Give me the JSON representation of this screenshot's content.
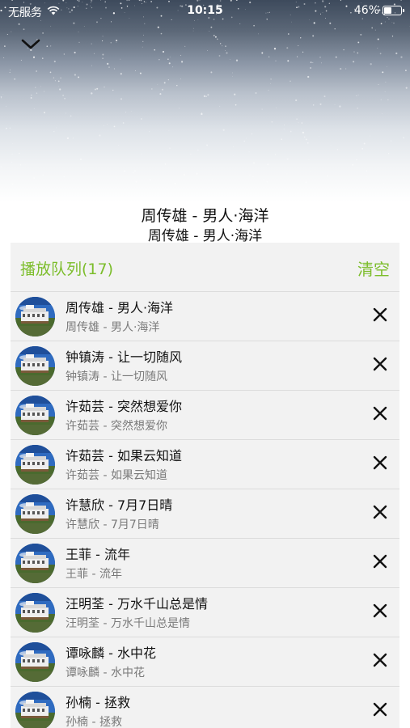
{
  "status_bar": {
    "carrier": "无服务",
    "time": "10:15",
    "battery_percent": "46%",
    "battery_level": 0.46,
    "icons": [
      "wifi-icon",
      "battery-icon"
    ]
  },
  "header": {
    "collapse_icon": "chevron-down-icon"
  },
  "now_playing": {
    "title": "周传雄 - 男人·海洋",
    "subtitle": "周传雄 - 男人·海洋"
  },
  "queue": {
    "title": "播放队列(17)",
    "clear_label": "清空",
    "accent_color": "#7cbd2b",
    "remove_icon": "close-icon",
    "items": [
      {
        "title": "周传雄 - 男人·海洋",
        "subtitle": "周传雄 - 男人·海洋"
      },
      {
        "title": "钟镇涛 - 让一切随风",
        "subtitle": "钟镇涛 - 让一切随风"
      },
      {
        "title": "许茹芸 - 突然想爱你",
        "subtitle": "许茹芸 - 突然想爱你"
      },
      {
        "title": "许茹芸 - 如果云知道",
        "subtitle": "许茹芸 - 如果云知道"
      },
      {
        "title": "许慧欣 - 7月7日晴",
        "subtitle": "许慧欣 - 7月7日晴"
      },
      {
        "title": "王菲 - 流年",
        "subtitle": "王菲 - 流年"
      },
      {
        "title": "汪明荃 - 万水千山总是情",
        "subtitle": "汪明荃 - 万水千山总是情"
      },
      {
        "title": "谭咏麟 - 水中花",
        "subtitle": "谭咏麟 - 水中花"
      },
      {
        "title": "孙楠 - 拯救",
        "subtitle": "孙楠 - 拯救"
      }
    ]
  }
}
